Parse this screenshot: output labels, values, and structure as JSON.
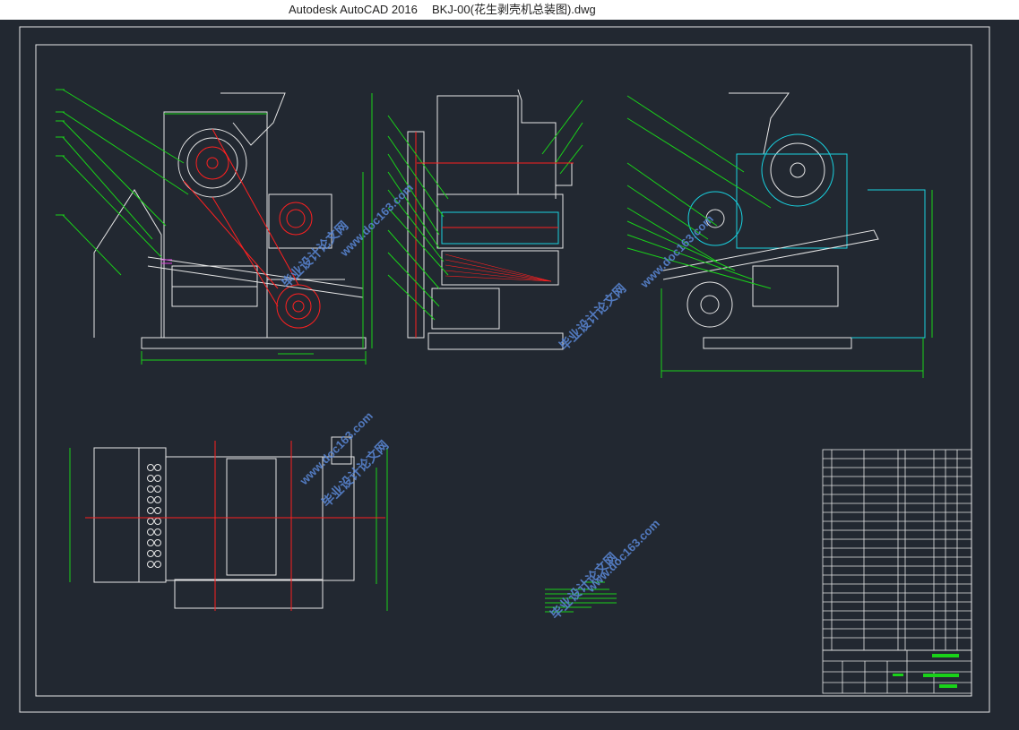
{
  "window": {
    "app_title": "Autodesk AutoCAD 2016",
    "file_title": "BKJ-00(花生剥壳机总装图).dwg"
  },
  "watermark": {
    "cn": "毕业设计论文网",
    "url": "www.doc163.com"
  },
  "colors": {
    "canvas_bg": "#222831",
    "line_white": "#e6e6e6",
    "dimension_green": "#19d219",
    "center_red": "#ff2020",
    "highlight_cyan": "#19d2e0",
    "magenta": "#e040e0",
    "watermark_blue": "#5a88d8"
  }
}
